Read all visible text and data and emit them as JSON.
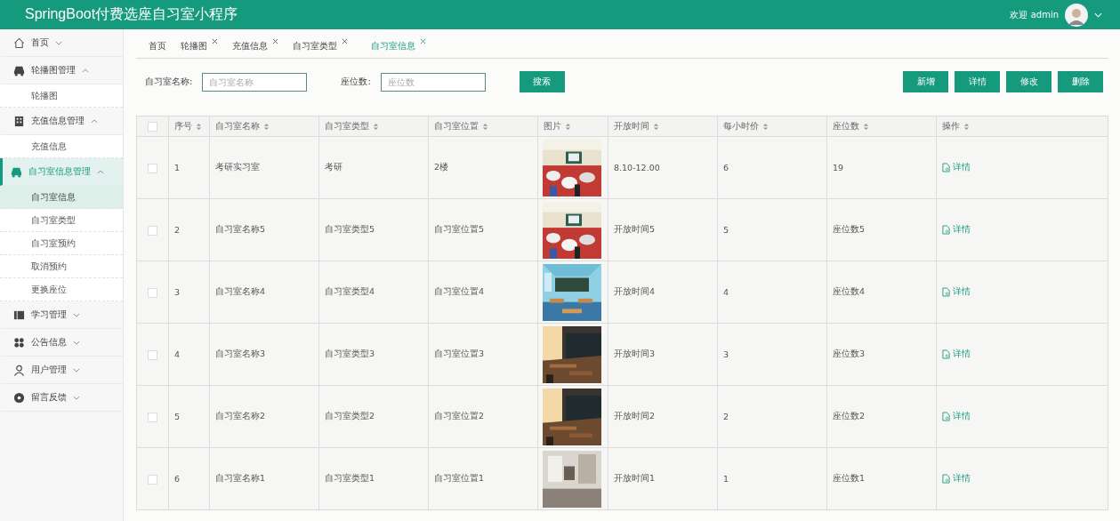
{
  "app_title": "SpringBoot付费选座自习室小程序",
  "user": {
    "greeting": "欢迎 admin"
  },
  "sidebar": {
    "items": [
      {
        "label": "首页",
        "expanded": false,
        "selected": false
      },
      {
        "label": "轮播图管理",
        "expanded": true,
        "selected": false,
        "children": [
          {
            "label": "轮播图",
            "selected": false
          }
        ]
      },
      {
        "label": "充值信息管理",
        "expanded": true,
        "selected": false,
        "children": [
          {
            "label": "充值信息",
            "selected": false
          }
        ]
      },
      {
        "label": "自习室信息管理",
        "expanded": true,
        "selected": true,
        "children": [
          {
            "label": "自习室信息",
            "selected": true
          },
          {
            "label": "自习室类型",
            "selected": false
          },
          {
            "label": "自习室预约",
            "selected": false
          },
          {
            "label": "取消预约",
            "selected": false
          },
          {
            "label": "更换座位",
            "selected": false
          }
        ]
      },
      {
        "label": "学习管理",
        "expanded": false,
        "selected": false
      },
      {
        "label": "公告信息",
        "expanded": false,
        "selected": false
      },
      {
        "label": "用户管理",
        "expanded": false,
        "selected": false
      },
      {
        "label": "留言反馈",
        "expanded": false,
        "selected": false
      }
    ]
  },
  "tabs": [
    {
      "label": "首页",
      "closable": false,
      "selected": false
    },
    {
      "label": "轮播图",
      "closable": true,
      "selected": false
    },
    {
      "label": "充值信息",
      "closable": true,
      "selected": false
    },
    {
      "label": "自习室类型",
      "closable": true,
      "selected": false
    },
    {
      "label": "自习室信息",
      "closable": true,
      "selected": true
    }
  ],
  "search": {
    "fields": [
      {
        "label": "自习室名称:",
        "placeholder": "自习室名称"
      },
      {
        "label": "座位数:",
        "placeholder": "座位数"
      }
    ],
    "button": "搜索"
  },
  "actions": [
    "新增",
    "详情",
    "修改",
    "删除"
  ],
  "table": {
    "select_all_checked": false,
    "columns": [
      "序号",
      "自习室名称",
      "自习室类型",
      "自习室位置",
      "图片",
      "开放时间",
      "每小时价",
      "座位数",
      "操作"
    ],
    "rows": [
      {
        "checked": false,
        "cells": [
          "1",
          "考研实习室",
          "考研",
          "2楼",
          "",
          "8.10-12.00",
          "6",
          "19",
          "详情"
        ]
      },
      {
        "checked": false,
        "cells": [
          "2",
          "自习室名称5",
          "自习室类型5",
          "自习室位置5",
          "",
          "开放时间5",
          "5",
          "座位数5",
          "详情"
        ]
      },
      {
        "checked": false,
        "cells": [
          "3",
          "自习室名称4",
          "自习室类型4",
          "自习室位置4",
          "",
          "开放时间4",
          "4",
          "座位数4",
          "详情"
        ]
      },
      {
        "checked": false,
        "cells": [
          "4",
          "自习室名称3",
          "自习室类型3",
          "自习室位置3",
          "",
          "开放时间3",
          "3",
          "座位数3",
          "详情"
        ]
      },
      {
        "checked": false,
        "cells": [
          "5",
          "自习室名称2",
          "自习室类型2",
          "自习室位置2",
          "",
          "开放时间2",
          "2",
          "座位数2",
          "详情"
        ]
      },
      {
        "checked": false,
        "cells": [
          "6",
          "自习室名称1",
          "自习室类型1",
          "自习室位置1",
          "",
          "开放时间1",
          "1",
          "座位数1",
          "详情"
        ]
      }
    ]
  }
}
